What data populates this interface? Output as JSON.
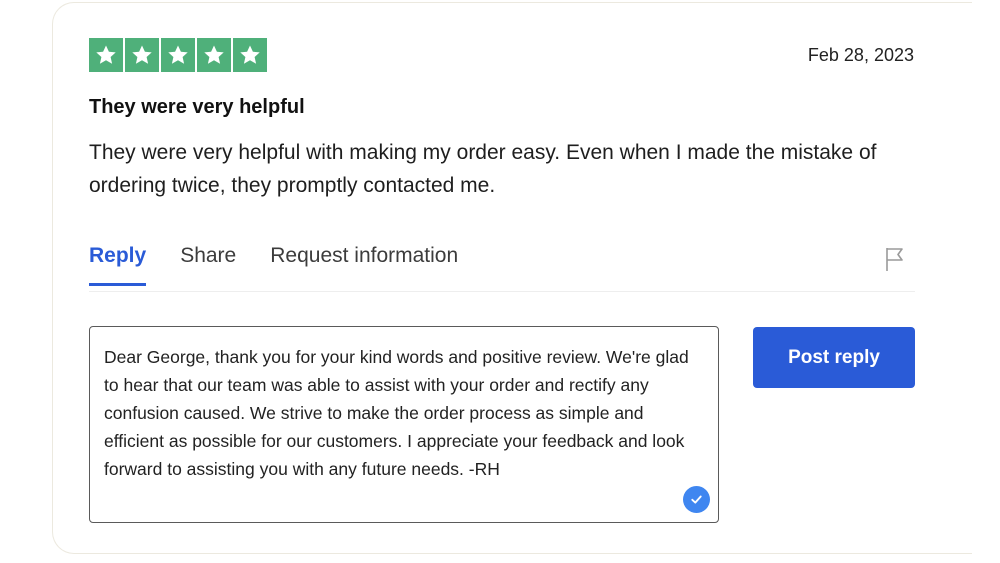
{
  "review": {
    "rating": 5,
    "rating_max": 5,
    "star_color": "#4fb07a",
    "date": "Feb 28, 2023",
    "title": "They were very helpful",
    "body": "They were very helpful with making my order easy. Even when I made the mistake of ordering twice, they promptly contacted me."
  },
  "tabs": [
    {
      "label": "Reply",
      "active": true
    },
    {
      "label": "Share",
      "active": false
    },
    {
      "label": "Request information",
      "active": false
    }
  ],
  "reply": {
    "text": "Dear George, thank you for your kind words and positive review. We're glad to hear that our team was able to assist with your order and rectify any confusion caused. We strive to make the order process as simple and efficient as possible for our customers. I appreciate your feedback and look forward to assisting you with any future needs. -RH",
    "post_label": "Post reply"
  },
  "colors": {
    "accent": "#2a5bd7",
    "check_badge": "#3f86f0"
  },
  "icons": {
    "star": "star-icon",
    "flag": "flag-icon",
    "check": "checkmark-icon"
  }
}
